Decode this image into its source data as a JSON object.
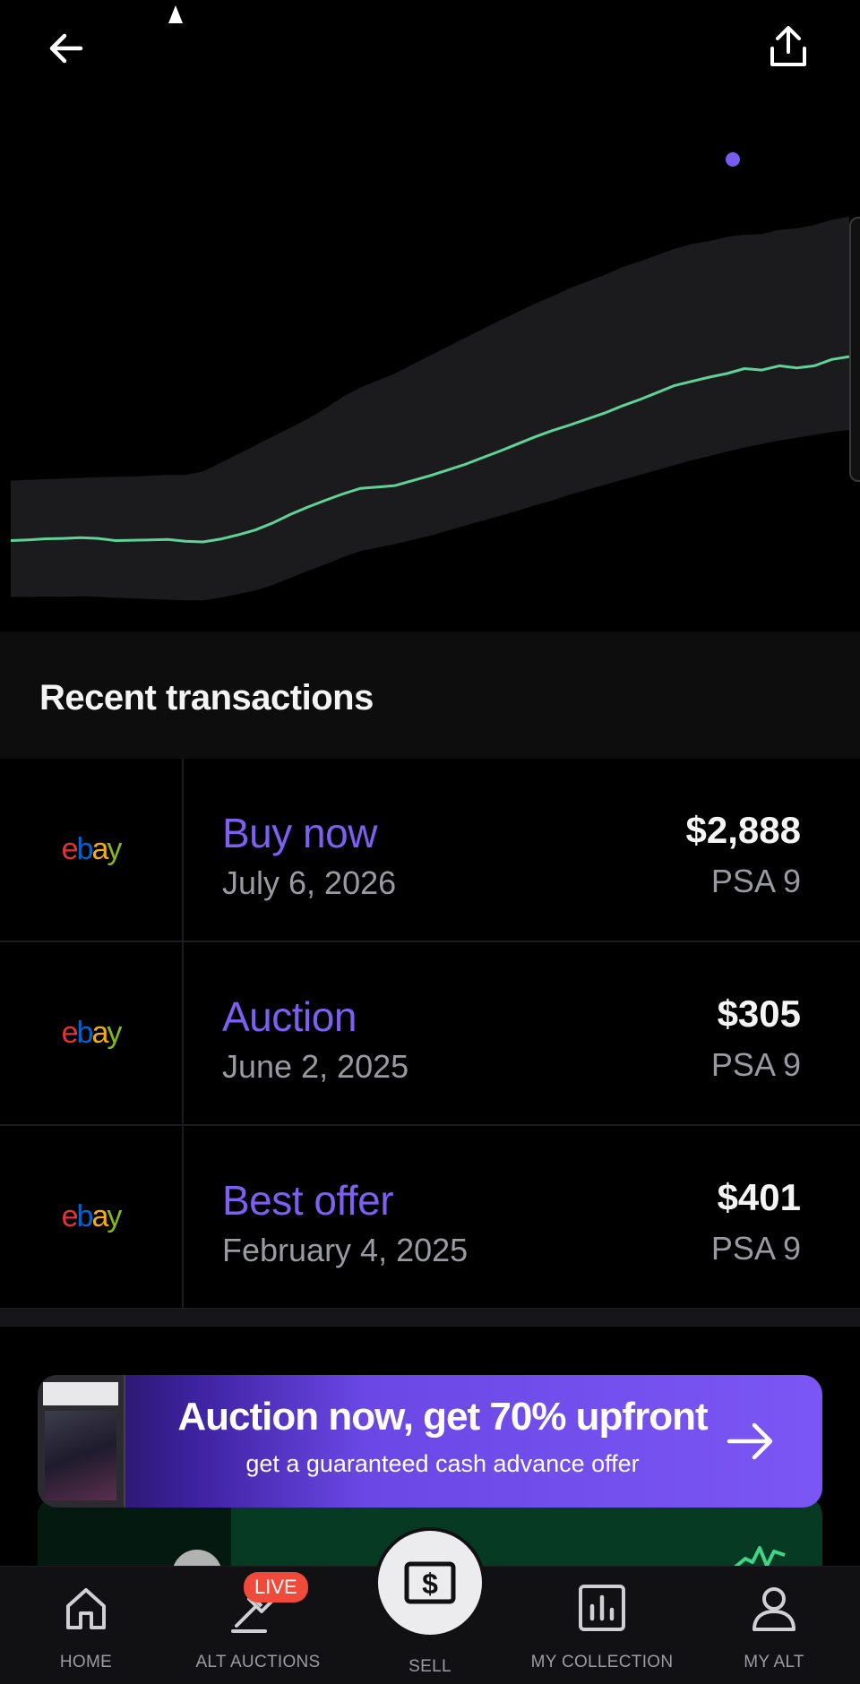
{
  "top_bar": {
    "back_icon": "arrow-left-icon",
    "share_icon": "share-upload-icon"
  },
  "chart_data": {
    "type": "line",
    "title": "",
    "xlabel": "",
    "ylabel": "",
    "x": [
      0,
      1,
      2,
      3,
      4,
      5,
      6,
      7,
      8,
      9,
      10,
      11,
      12,
      13,
      14,
      15,
      16,
      17,
      18,
      19,
      20,
      21,
      22,
      23,
      24,
      25,
      26,
      27,
      28,
      29,
      30,
      31,
      32,
      33,
      34,
      35,
      36,
      37,
      38,
      39,
      40,
      41,
      42,
      43,
      44,
      45,
      46,
      47,
      48
    ],
    "series": [
      {
        "values": [
          22,
          22.2,
          22.5,
          22.6,
          22.8,
          22.6,
          22,
          22.1,
          22.2,
          22.3,
          21.8,
          21.6,
          22.4,
          23.6,
          25,
          27,
          29.4,
          31.5,
          33.4,
          35.2,
          36.8,
          37.2,
          37.6,
          39,
          40.4,
          42,
          43.6,
          45.5,
          47.4,
          49.4,
          51.4,
          53.2,
          54.8,
          56.5,
          58.2,
          60.2,
          62,
          64,
          66,
          67.2,
          68.4,
          69.4,
          70.8,
          70.4,
          71.6,
          71,
          71.6,
          73.4,
          74.2
        ]
      },
      {
        "band_upper": [
          39,
          39.2,
          39.4,
          39.6,
          39.8,
          40,
          40.1,
          40.2,
          40.4,
          40.6,
          40.6,
          41.6,
          44,
          46.5,
          49,
          51.5,
          54,
          56.5,
          59.5,
          62.8,
          65.4,
          67.4,
          69.4,
          72,
          74.5,
          77,
          79.5,
          82,
          84.5,
          86.8,
          89.2,
          91.3,
          93.6,
          95.5,
          97.4,
          99.6,
          101.2,
          103,
          104.8,
          106.2,
          107,
          108.2,
          108.8,
          109,
          110.2,
          110.6,
          111.6,
          113,
          114
        ]
      },
      {
        "band_lower": [
          6,
          6,
          6.1,
          6,
          6.2,
          6,
          5.8,
          5.6,
          5.4,
          5.2,
          5,
          5,
          5.8,
          6.8,
          7.8,
          9.4,
          11.4,
          13.4,
          15.2,
          17.2,
          19,
          20,
          21,
          22.2,
          23.4,
          24.8,
          26.2,
          27.6,
          29,
          30.4,
          32,
          33.4,
          35,
          36.4,
          37.8,
          39.2,
          40.6,
          42,
          43.4,
          44.8,
          46,
          47.2,
          48.4,
          49.4,
          50.4,
          51.2,
          52,
          52.8,
          53.4
        ]
      }
    ],
    "ylim": [
      0,
      150
    ],
    "colors": {
      "line": "#5fd29a",
      "band": "#1b1b1d",
      "marker": "#7b5cf0"
    }
  },
  "transactions": {
    "title": "Recent transactions",
    "items": [
      {
        "source": "ebay",
        "type": "Buy now",
        "date": "July 6, 2026",
        "price": "$2,888",
        "grade": "PSA 9"
      },
      {
        "source": "ebay",
        "type": "Auction",
        "date": "June 2, 2025",
        "price": "$305",
        "grade": "PSA 9"
      },
      {
        "source": "ebay",
        "type": "Best offer",
        "date": "February 4, 2025",
        "price": "$401",
        "grade": "PSA 9"
      }
    ]
  },
  "promo": {
    "title": "Auction now, get 70% upfront",
    "subtitle": "get a guaranteed cash advance offer",
    "arrow_icon": "arrow-right-icon",
    "colors": {
      "start": "#1a0f3f",
      "end": "#7b56f4"
    }
  },
  "bottom_nav": {
    "items": [
      {
        "label": "HOME",
        "icon": "home-icon"
      },
      {
        "label": "ALT AUCTIONS",
        "icon": "gavel-icon",
        "badge": "LIVE"
      },
      {
        "label": "SELL",
        "icon": "dollar-bill-icon"
      },
      {
        "label": "MY COLLECTION",
        "icon": "bar-chart-icon"
      },
      {
        "label": "MY ALT",
        "icon": "user-icon"
      }
    ]
  },
  "colors": {
    "accent": "#7e5ff2",
    "live": "#ef4a3a",
    "background": "#000000"
  }
}
